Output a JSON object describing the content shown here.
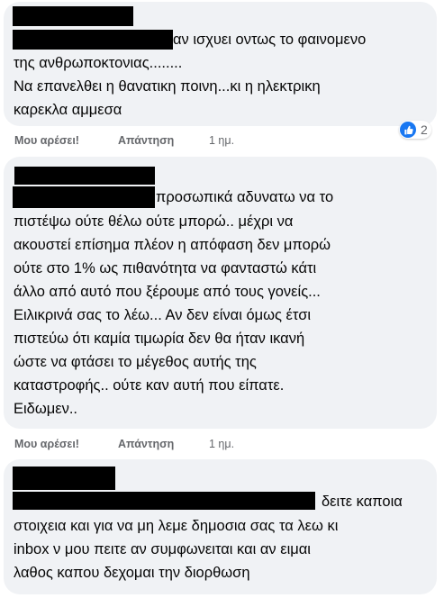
{
  "comments": [
    {
      "lines": [
        "αν ισχυει οντως το φαινομενο",
        "της ανθρωποκτονιας........",
        "Να επανελθει η θανατικη ποινη...κι η ηλεκτρικη",
        "καρεκλα αμμεσα"
      ],
      "actions": {
        "like": "Μου αρέσει!",
        "reply": "Απάντηση",
        "time": "1 ημ."
      },
      "reaction": {
        "icon": "thumbs-up-icon",
        "count": "2"
      }
    },
    {
      "lines": [
        "προσωπικά αδυνατω να το",
        "πιστέψω ούτε θέλω ούτε μπορώ.. μέχρι να",
        "ακουστεί επίσημα πλέον η απόφαση δεν μπορώ",
        "ούτε στο 1% ως πιθανότητα να φανταστώ κάτι",
        "άλλο από αυτό που ξέρουμε από τους γονείς...",
        "Ειλικρινά σας το λέω... Αν δεν είναι όμως έτσι",
        "πιστεύω ότι καμία τιμωρία δεν θα ήταν ικανή",
        "ώστε να φτάσει το μέγεθος αυτής της",
        "καταστροφής.. ούτε καν αυτή που είπατε.",
        "Ειδωμεν.."
      ],
      "actions": {
        "like": "Μου αρέσει!",
        "reply": "Απάντηση",
        "time": "1 ημ."
      }
    },
    {
      "lines": [
        "δειτε καποια",
        "στοιχεια και για να μη λεμε δημοσια σας τα λεω κι",
        "inbox ν μου πειτε αν συμφωνειται και αν ειμαι",
        "λαθος καπου δεχομαι την διορθωση"
      ]
    }
  ],
  "colors": {
    "bubble": "#f0f2f5",
    "secondary_text": "#65676b",
    "like_blue": "#1877f2"
  }
}
